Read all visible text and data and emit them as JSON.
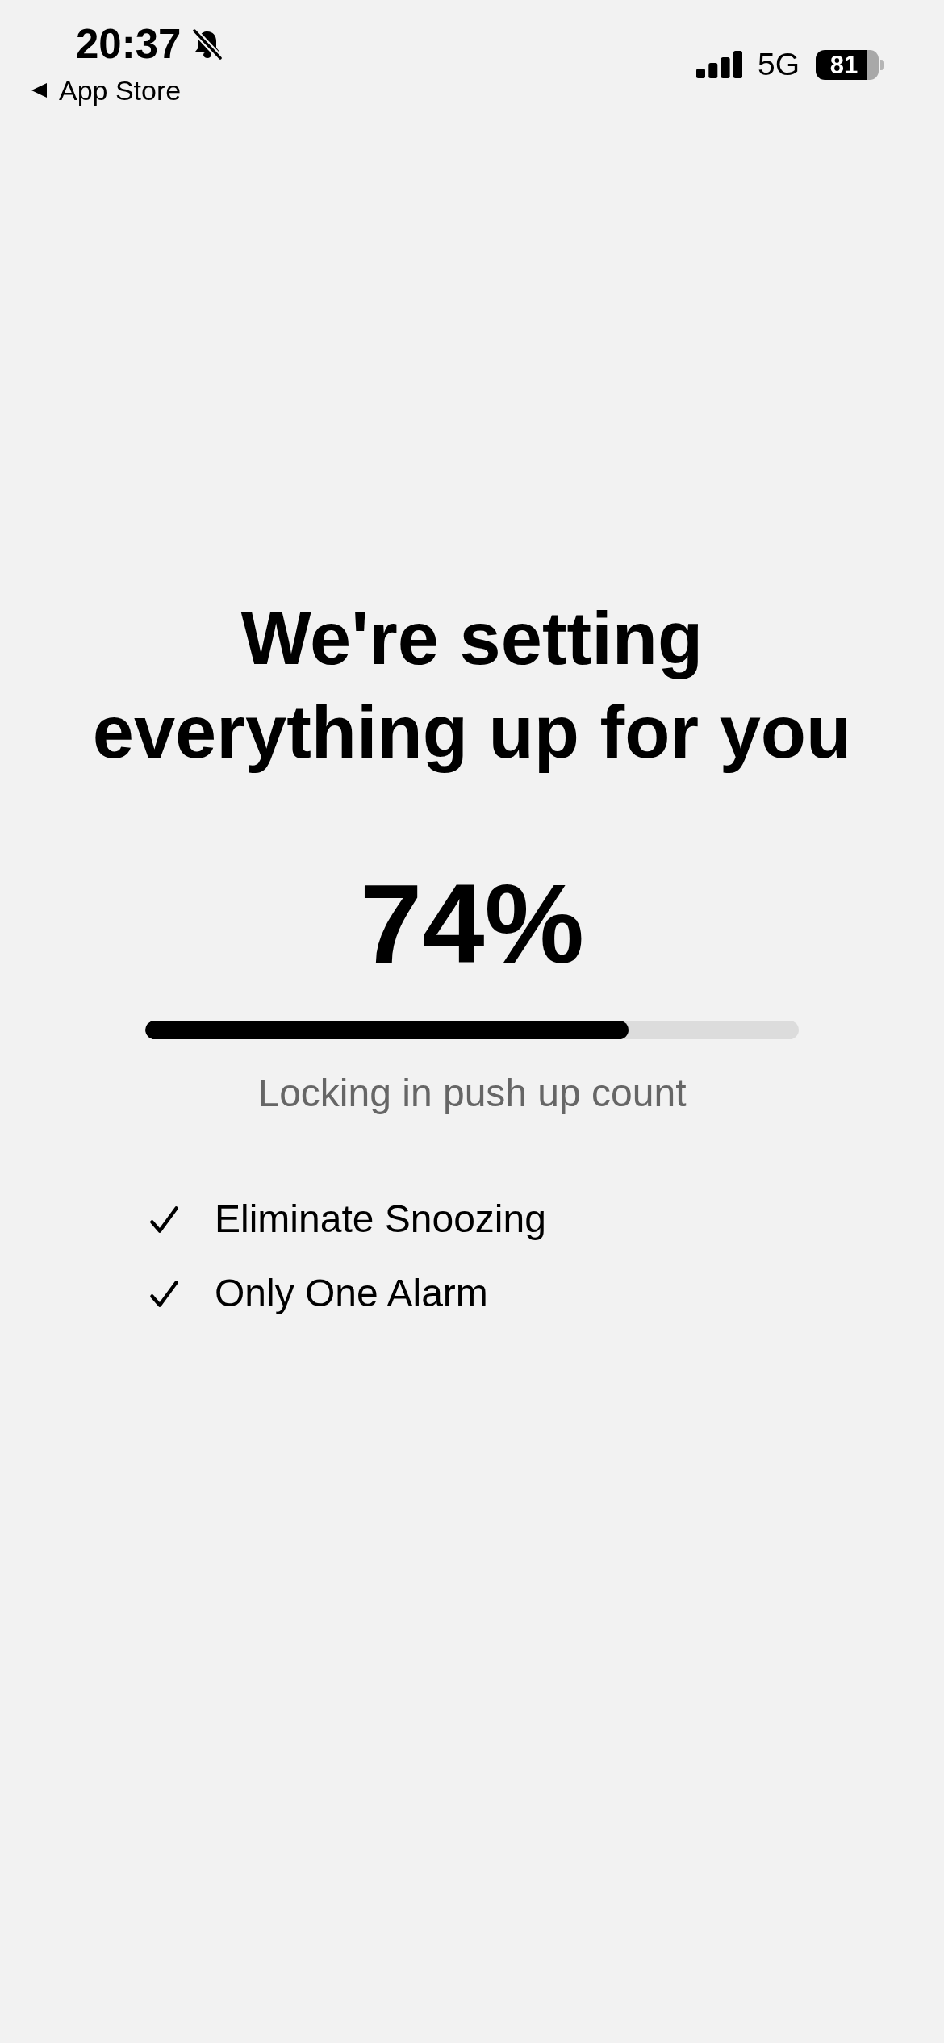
{
  "status_bar": {
    "time": "20:37",
    "silent_mode": true,
    "back_label": "App Store",
    "network": "5G",
    "battery": "81"
  },
  "title": "We're setting everything up for you",
  "progress": {
    "percent_label": "74%",
    "level": 0.74,
    "caption": "Locking in push up count"
  },
  "checklist": [
    {
      "label": "Eliminate Snoozing",
      "checked": true
    },
    {
      "label": "Only One Alarm",
      "checked": true
    }
  ]
}
